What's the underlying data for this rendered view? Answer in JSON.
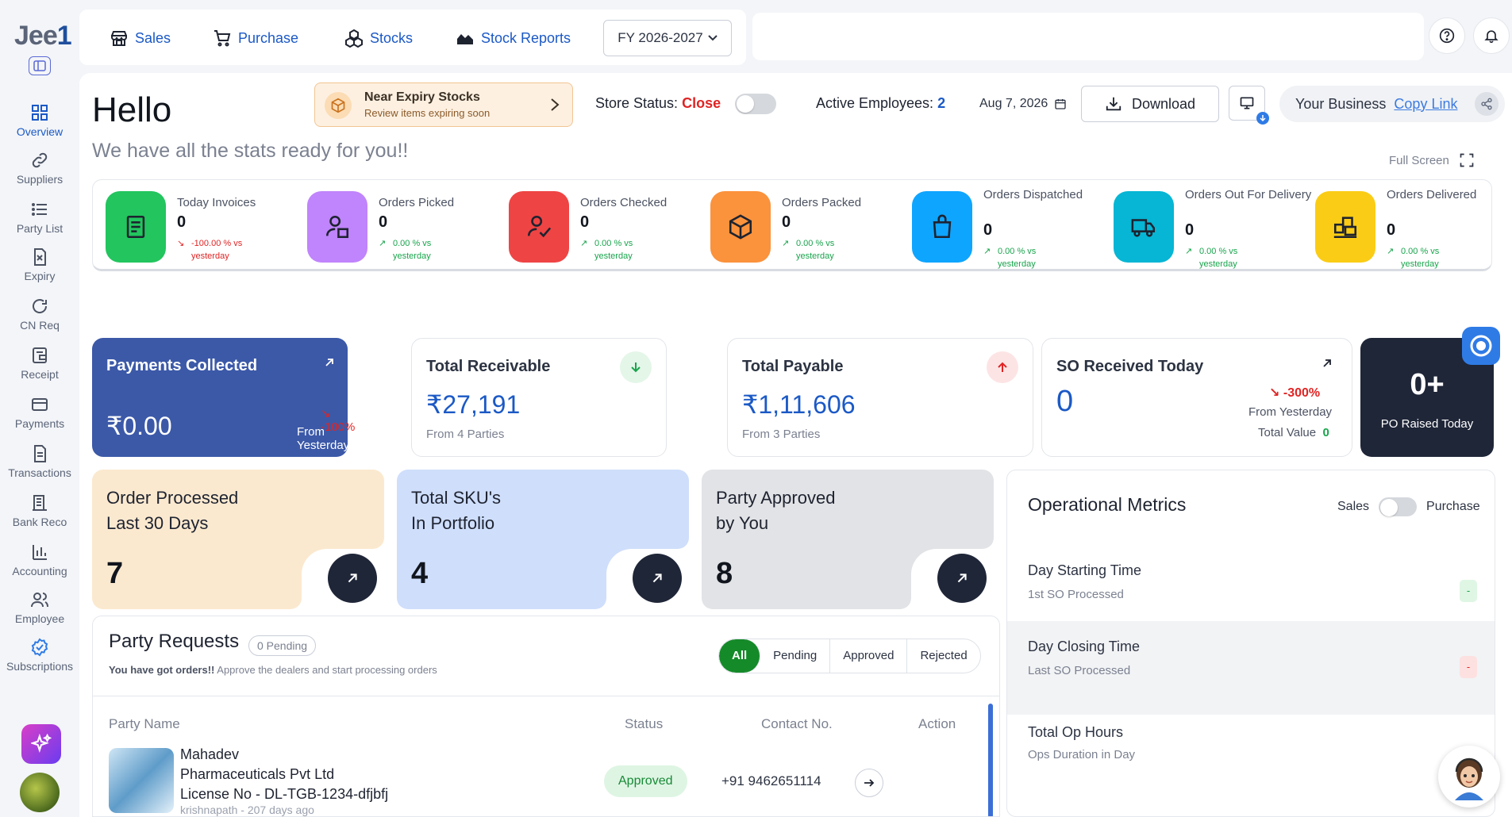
{
  "brand": {
    "logo_main": "Jee",
    "logo_num": "1"
  },
  "sidebar": {
    "items": [
      {
        "label": "Overview",
        "icon": "grid-icon"
      },
      {
        "label": "Suppliers",
        "icon": "link-icon"
      },
      {
        "label": "Party List",
        "icon": "list-icon"
      },
      {
        "label": "Expiry",
        "icon": "expiry-file-icon"
      },
      {
        "label": "CN Req",
        "icon": "refresh-icon"
      },
      {
        "label": "Receipt",
        "icon": "receipt-icon"
      },
      {
        "label": "Payments",
        "icon": "card-icon"
      },
      {
        "label": "Transactions",
        "icon": "document-icon"
      },
      {
        "label": "Bank Reco",
        "icon": "bank-icon"
      },
      {
        "label": "Accounting",
        "icon": "bar-chart-icon"
      },
      {
        "label": "Employee",
        "icon": "users-icon"
      },
      {
        "label": "Subscriptions",
        "icon": "verified-badge-icon"
      }
    ]
  },
  "topnav": {
    "links": [
      "Sales",
      "Purchase",
      "Stocks",
      "Stock Reports"
    ],
    "fy": "FY 2026-2027"
  },
  "header": {
    "greeting": "Hello",
    "subtitle": "We have all the stats ready for you!!",
    "expiry_title": "Near Expiry Stocks",
    "expiry_sub": "Review items expiring soon",
    "store_label": "Store Status:",
    "store_value": "Close",
    "emp_label": "Active Employees:",
    "emp_value": "2",
    "date": "Aug 7, 2026",
    "download": "Download",
    "biz_label": "Your Business",
    "biz_link": "Copy Link",
    "fullscreen": "Full Screen"
  },
  "stats": [
    {
      "label": "Today Invoices",
      "value": "0",
      "change": "-100.00 % vs yesterday",
      "trend": "down",
      "color": "#22c55e"
    },
    {
      "label": "Orders Picked",
      "value": "0",
      "change": "0.00 % vs yesterday",
      "trend": "up",
      "color": "#c084fc"
    },
    {
      "label": "Orders Checked",
      "value": "0",
      "change": "0.00 % vs yesterday",
      "trend": "up",
      "color": "#ef4444"
    },
    {
      "label": "Orders Packed",
      "value": "0",
      "change": "0.00 % vs yesterday",
      "trend": "up",
      "color": "#fb923c"
    },
    {
      "label": "Orders Dispatched",
      "value": "0",
      "change": "0.00 % vs yesterday",
      "trend": "up",
      "color": "#0ea5ff"
    },
    {
      "label": "Orders Out For Delivery",
      "value": "0",
      "change": "0.00 % vs yesterday",
      "trend": "up",
      "color": "#06b6d4"
    },
    {
      "label": "Orders Delivered",
      "value": "0",
      "change": "0.00 % vs yesterday",
      "trend": "up",
      "color": "#facc15"
    }
  ],
  "payments": {
    "collected_title": "Payments Collected",
    "collected_value": "₹0.00",
    "collected_change": "-100%",
    "collected_from": "From Yesterday",
    "receivable_title": "Total Receivable",
    "receivable_value": "₹27,191",
    "receivable_from": "From 4 Parties",
    "payable_title": "Total Payable",
    "payable_value": "₹1,11,606",
    "payable_from": "From 3 Parties",
    "so_title": "SO Received Today",
    "so_value": "0",
    "so_change": "-300%",
    "so_from": "From Yesterday",
    "so_total_label": "Total Value",
    "so_total_value": "0",
    "po_value": "0+",
    "po_label": "PO Raised Today"
  },
  "features": [
    {
      "line1": "Order Processed",
      "line2": "Last 30 Days",
      "value": "7",
      "bg": "#fbe9cf"
    },
    {
      "line1": "Total SKU's",
      "line2": "In Portfolio",
      "value": "4",
      "bg": "#cfdefb"
    },
    {
      "line1": "Party Approved",
      "line2": "by You",
      "value": "8",
      "bg": "#e2e3e6"
    }
  ],
  "party_requests": {
    "title": "Party Requests",
    "pending": "0 Pending",
    "sub_bold": "You have got orders!!",
    "sub_rest": " Approve the dealers and start processing orders",
    "filters": [
      "All",
      "Pending",
      "Approved",
      "Rejected"
    ],
    "columns": [
      "Party Name",
      "Status",
      "Contact No.",
      "Action"
    ],
    "rows": [
      {
        "name1": "Mahadev",
        "name2": "Pharmaceuticals Pvt Ltd",
        "license": "License No - DL-TGB-1234-dfjbfj",
        "meta": "krishnapath - 207 days ago",
        "status": "Approved",
        "phone": "+91 9462651114"
      }
    ]
  },
  "ops": {
    "title": "Operational Metrics",
    "toggle_left": "Sales",
    "toggle_right": "Purchase",
    "sections": [
      {
        "title": "Day Starting Time",
        "sub": "1st SO Processed",
        "value": "-"
      },
      {
        "title": "Day Closing Time",
        "sub": "Last SO Processed",
        "value": "-"
      },
      {
        "title": "Total Op Hours",
        "sub": "Ops Duration in Day",
        "value": ""
      }
    ]
  }
}
